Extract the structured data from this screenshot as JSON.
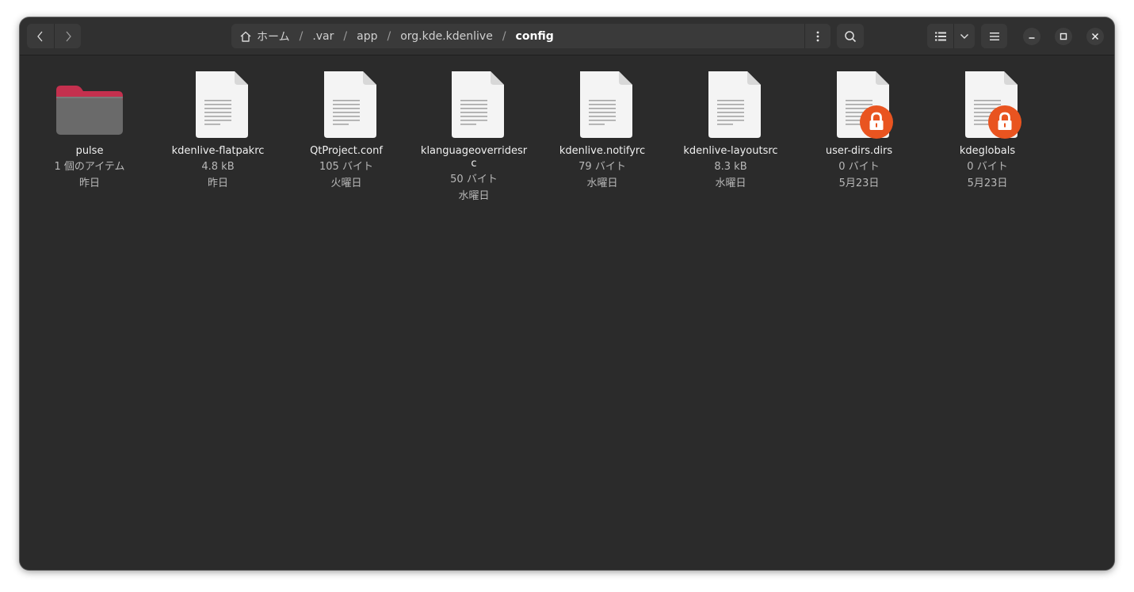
{
  "window": {
    "path": {
      "home_label": "ホーム",
      "segments": [
        ".var",
        "app",
        "org.kde.kdenlive"
      ],
      "current": "config"
    }
  },
  "icons": {
    "back": "chevron-left-icon",
    "forward": "chevron-right-icon",
    "home": "home-icon",
    "path_menu": "kebab-menu-icon",
    "search": "search-icon",
    "view": "list-view-icon",
    "view_dropdown": "chevron-down-icon",
    "main_menu": "hamburger-menu-icon",
    "minimize": "minimize-icon",
    "maximize": "maximize-icon",
    "close": "close-icon",
    "folder": "folder-icon",
    "text_file": "text-file-icon",
    "lock": "lock-icon"
  },
  "colors": {
    "folder_accent": "#c4304e",
    "lock_badge": "#e95420",
    "window_bg": "#2b2b2b"
  },
  "files": [
    {
      "name": "pulse",
      "size": "1 個のアイテム",
      "date": "昨日",
      "type": "folder",
      "locked": false
    },
    {
      "name": "kdenlive-flatpakrc",
      "size": "4.8 kB",
      "date": "昨日",
      "type": "text",
      "locked": false
    },
    {
      "name": "QtProject.conf",
      "size": "105 バイト",
      "date": "火曜日",
      "type": "text",
      "locked": false
    },
    {
      "name": "klanguageoverridesrc",
      "size": "50 バイト",
      "date": "水曜日",
      "type": "text",
      "locked": false
    },
    {
      "name": "kdenlive.notifyrc",
      "size": "79 バイト",
      "date": "水曜日",
      "type": "text",
      "locked": false
    },
    {
      "name": "kdenlive-layoutsrc",
      "size": "8.3 kB",
      "date": "水曜日",
      "type": "text",
      "locked": false
    },
    {
      "name": "user-dirs.dirs",
      "size": "0 バイト",
      "date": "5月23日",
      "type": "text",
      "locked": true
    },
    {
      "name": "kdeglobals",
      "size": "0 バイト",
      "date": "5月23日",
      "type": "text",
      "locked": true
    }
  ]
}
